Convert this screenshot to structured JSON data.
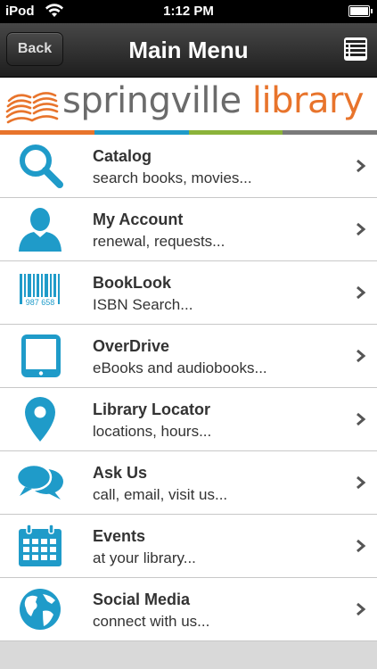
{
  "status_bar": {
    "carrier": "iPod",
    "time": "1:12 PM"
  },
  "nav": {
    "back_label": "Back",
    "title": "Main Menu"
  },
  "logo": {
    "word1": "springville",
    "word2": "library"
  },
  "colors": {
    "accent": "#1f9bc9",
    "brand_orange": "#e8742c",
    "strip": [
      "#e8742c",
      "#1f9bc9",
      "#8bb33a",
      "#7a7a7a"
    ]
  },
  "menu": [
    {
      "title": "Catalog",
      "subtitle": "search books, movies...",
      "icon": "search-icon"
    },
    {
      "title": "My Account",
      "subtitle": "renewal, requests...",
      "icon": "person-icon"
    },
    {
      "title": "BookLook",
      "subtitle": "ISBN Search...",
      "icon": "barcode-icon",
      "icon_text": "987 658"
    },
    {
      "title": "OverDrive",
      "subtitle": "eBooks and audiobooks...",
      "icon": "tablet-icon"
    },
    {
      "title": "Library Locator",
      "subtitle": "locations, hours...",
      "icon": "map-pin-icon"
    },
    {
      "title": "Ask Us",
      "subtitle": "call, email, visit us...",
      "icon": "chat-bubbles-icon"
    },
    {
      "title": "Events",
      "subtitle": "at your library...",
      "icon": "calendar-icon"
    },
    {
      "title": "Social Media",
      "subtitle": "connect with us...",
      "icon": "globe-icon"
    }
  ]
}
